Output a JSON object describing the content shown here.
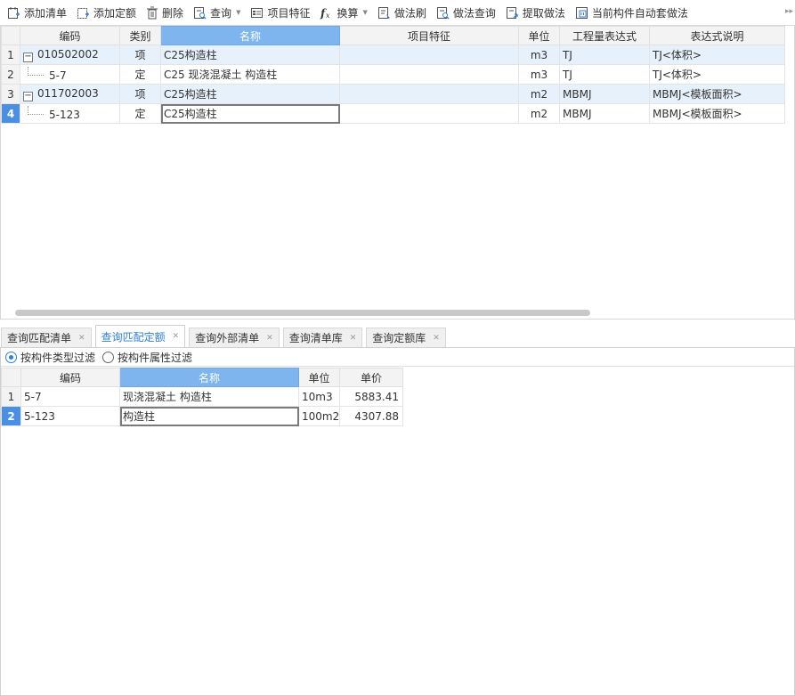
{
  "toolbar": {
    "add_list": "添加清单",
    "add_quota": "添加定额",
    "delete": "删除",
    "query": "查询",
    "item_features": "项目特征",
    "convert": "换算",
    "method_brush": "做法刷",
    "method_query": "做法查询",
    "extract_method": "提取做法",
    "auto_method": "当前构件自动套做法"
  },
  "top_grid": {
    "columns": [
      "编码",
      "类别",
      "名称",
      "项目特征",
      "单位",
      "工程量表达式",
      "表达式说明"
    ],
    "rows": [
      {
        "num": "1",
        "code": "010502002",
        "type": "项",
        "name": "C25构造柱",
        "feature": "",
        "unit": "m3",
        "expr": "TJ",
        "desc": "TJ<体积>"
      },
      {
        "num": "2",
        "code": "5-7",
        "type": "定",
        "name": "C25 现浇混凝土 构造柱",
        "feature": "",
        "unit": "m3",
        "expr": "TJ",
        "desc": "TJ<体积>"
      },
      {
        "num": "3",
        "code": "011702003",
        "type": "项",
        "name": "C25构造柱",
        "feature": "",
        "unit": "m2",
        "expr": "MBMJ",
        "desc": "MBMJ<模板面积>"
      },
      {
        "num": "4",
        "code": "5-123",
        "type": "定",
        "name": "C25构造柱",
        "feature": "",
        "unit": "m2",
        "expr": "MBMJ",
        "desc": "MBMJ<模板面积>"
      }
    ]
  },
  "tabs": [
    "查询匹配清单",
    "查询匹配定额",
    "查询外部清单",
    "查询清单库",
    "查询定额库"
  ],
  "filter": {
    "by_type": "按构件类型过滤",
    "by_attr": "按构件属性过滤"
  },
  "bottom_grid": {
    "columns": [
      "编码",
      "名称",
      "单位",
      "单价"
    ],
    "rows": [
      {
        "num": "1",
        "code": "5-7",
        "name": "现浇混凝土 构造柱",
        "unit": "10m3",
        "price": "5883.41"
      },
      {
        "num": "2",
        "code": "5-123",
        "name": "构造柱",
        "unit": "100m2",
        "price": "4307.88"
      }
    ]
  },
  "colors": {
    "accent": "#2f7fd6",
    "selected_header": "#7eb5ef",
    "row_highlight": "#e6f1fb"
  }
}
